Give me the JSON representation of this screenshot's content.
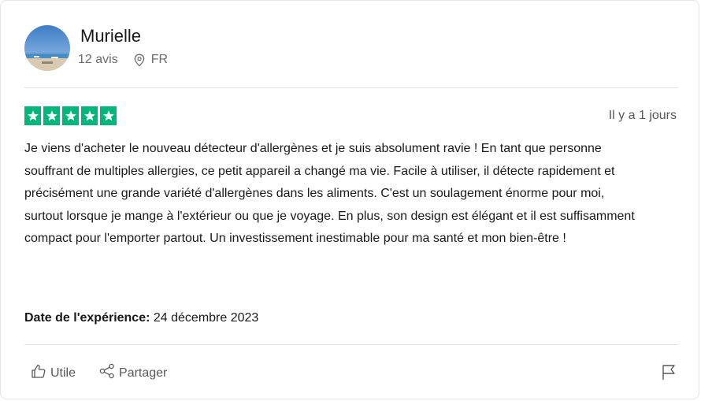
{
  "reviewer": {
    "name": "Murielle",
    "review_count": "12 avis",
    "country": "FR",
    "avatar_icon": "profile-photo-beach"
  },
  "rating": {
    "stars": 5,
    "max_stars": 5,
    "star_color": "#00b67a"
  },
  "posted_ago": "Il y a 1 jours",
  "review_text": "Je viens d'acheter le nouveau détecteur d'allergènes et je suis absolument ravie ! En tant que personne souffrant de multiples allergies, ce petit appareil a changé ma vie. Facile à utiliser, il détecte rapidement et précisément une grande variété d'allergènes dans les aliments. C'est un soulagement énorme pour moi, surtout lorsque je mange à l'extérieur ou que je voyage. En plus, son design est élégant et il est suffisamment compact pour l'emporter partout. Un investissement inestimable pour ma santé et mon bien-être !",
  "experience": {
    "label": "Date de l'expérience:",
    "date": "24 décembre 2023"
  },
  "actions": {
    "useful_label": "Utile",
    "share_label": "Partager",
    "useful_icon": "thumbs-up-icon",
    "share_icon": "share-icon",
    "report_icon": "flag-icon"
  }
}
